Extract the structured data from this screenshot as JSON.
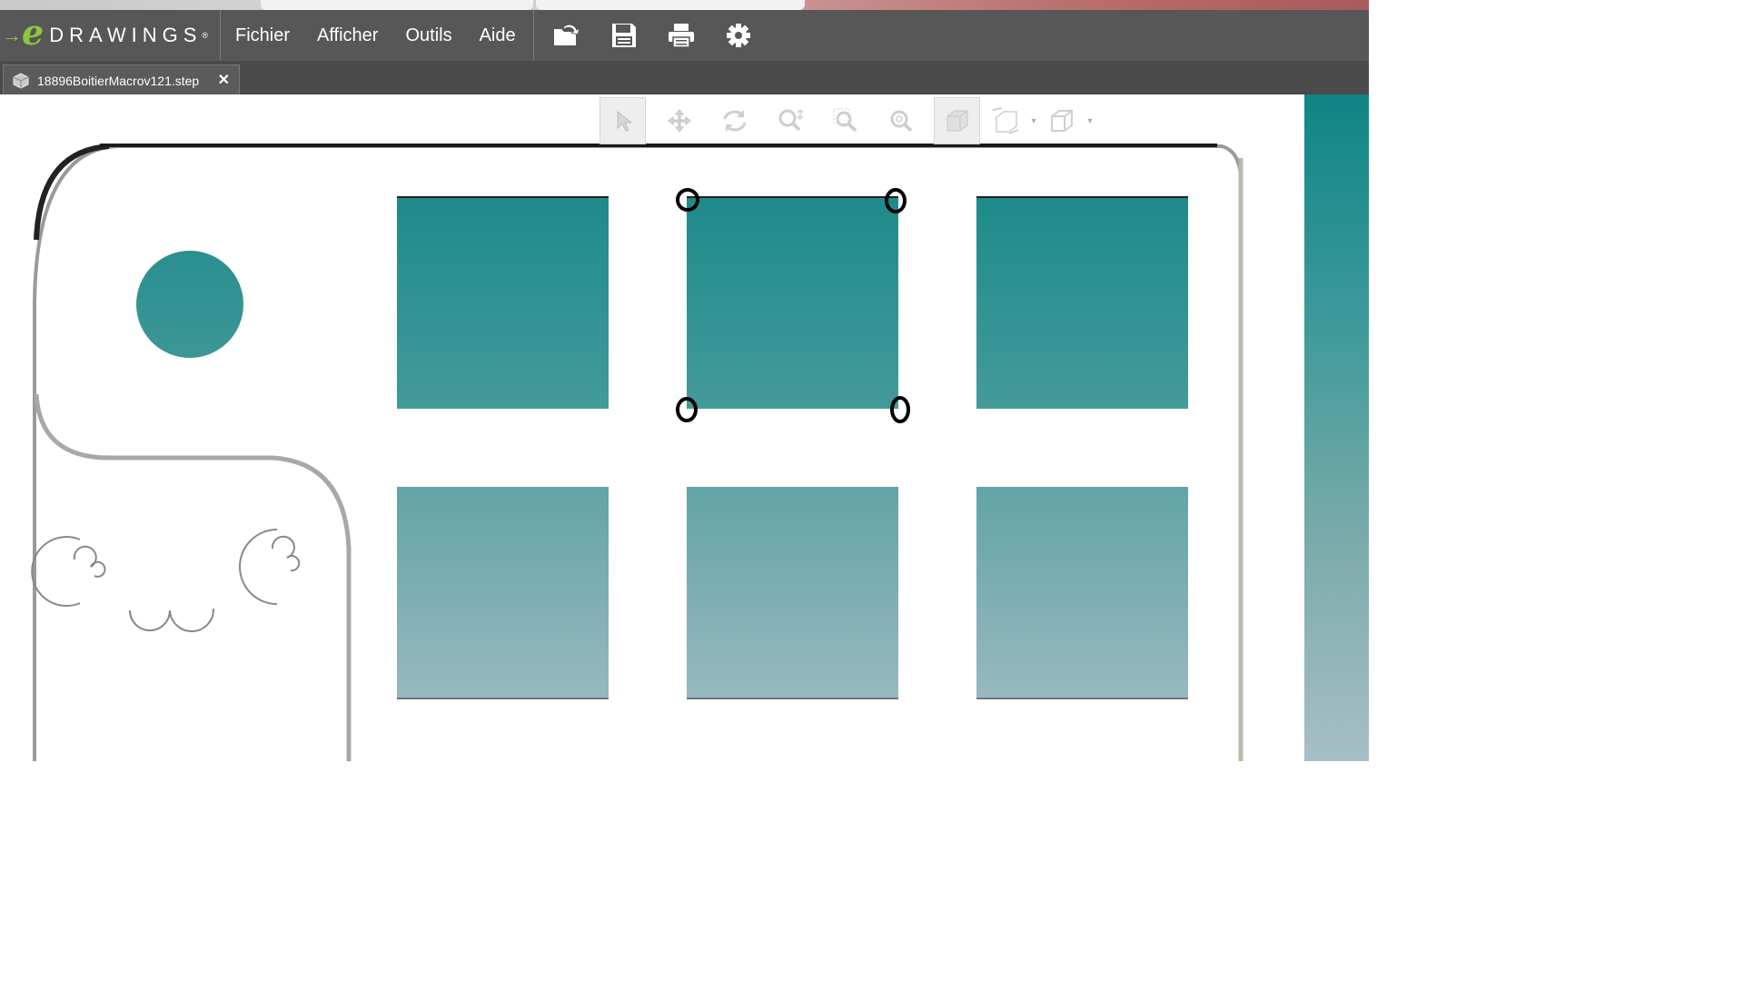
{
  "app": {
    "logo_arrow": "→",
    "logo_e": "e",
    "logo_word": "DRAWINGS",
    "logo_reg": "®"
  },
  "menu": {
    "items": [
      {
        "label": "Fichier"
      },
      {
        "label": "Afficher"
      },
      {
        "label": "Outils"
      },
      {
        "label": "Aide"
      }
    ]
  },
  "toolbar": {
    "icons": [
      "open-folder-icon",
      "save-icon",
      "print-icon",
      "gear-icon"
    ]
  },
  "tab": {
    "filename": "18896BoitierMacrov121.step",
    "close_glyph": "✕"
  },
  "view_toolbar": {
    "icons": [
      "select-arrow-icon",
      "pan-icon",
      "rotate-icon",
      "zoom-icon",
      "zoom-area-icon",
      "zoom-fit-icon",
      "shaded-cube-icon",
      "section-view-icon",
      "view-orientation-icon"
    ],
    "active": "shaded-cube-icon"
  },
  "colors": {
    "menubar": "#575757",
    "tabbar": "#4a4a4a",
    "accent_green": "#8dc63f",
    "part_teal_top": "#1f8b8b",
    "part_teal_bottom": "#96b8c0"
  }
}
